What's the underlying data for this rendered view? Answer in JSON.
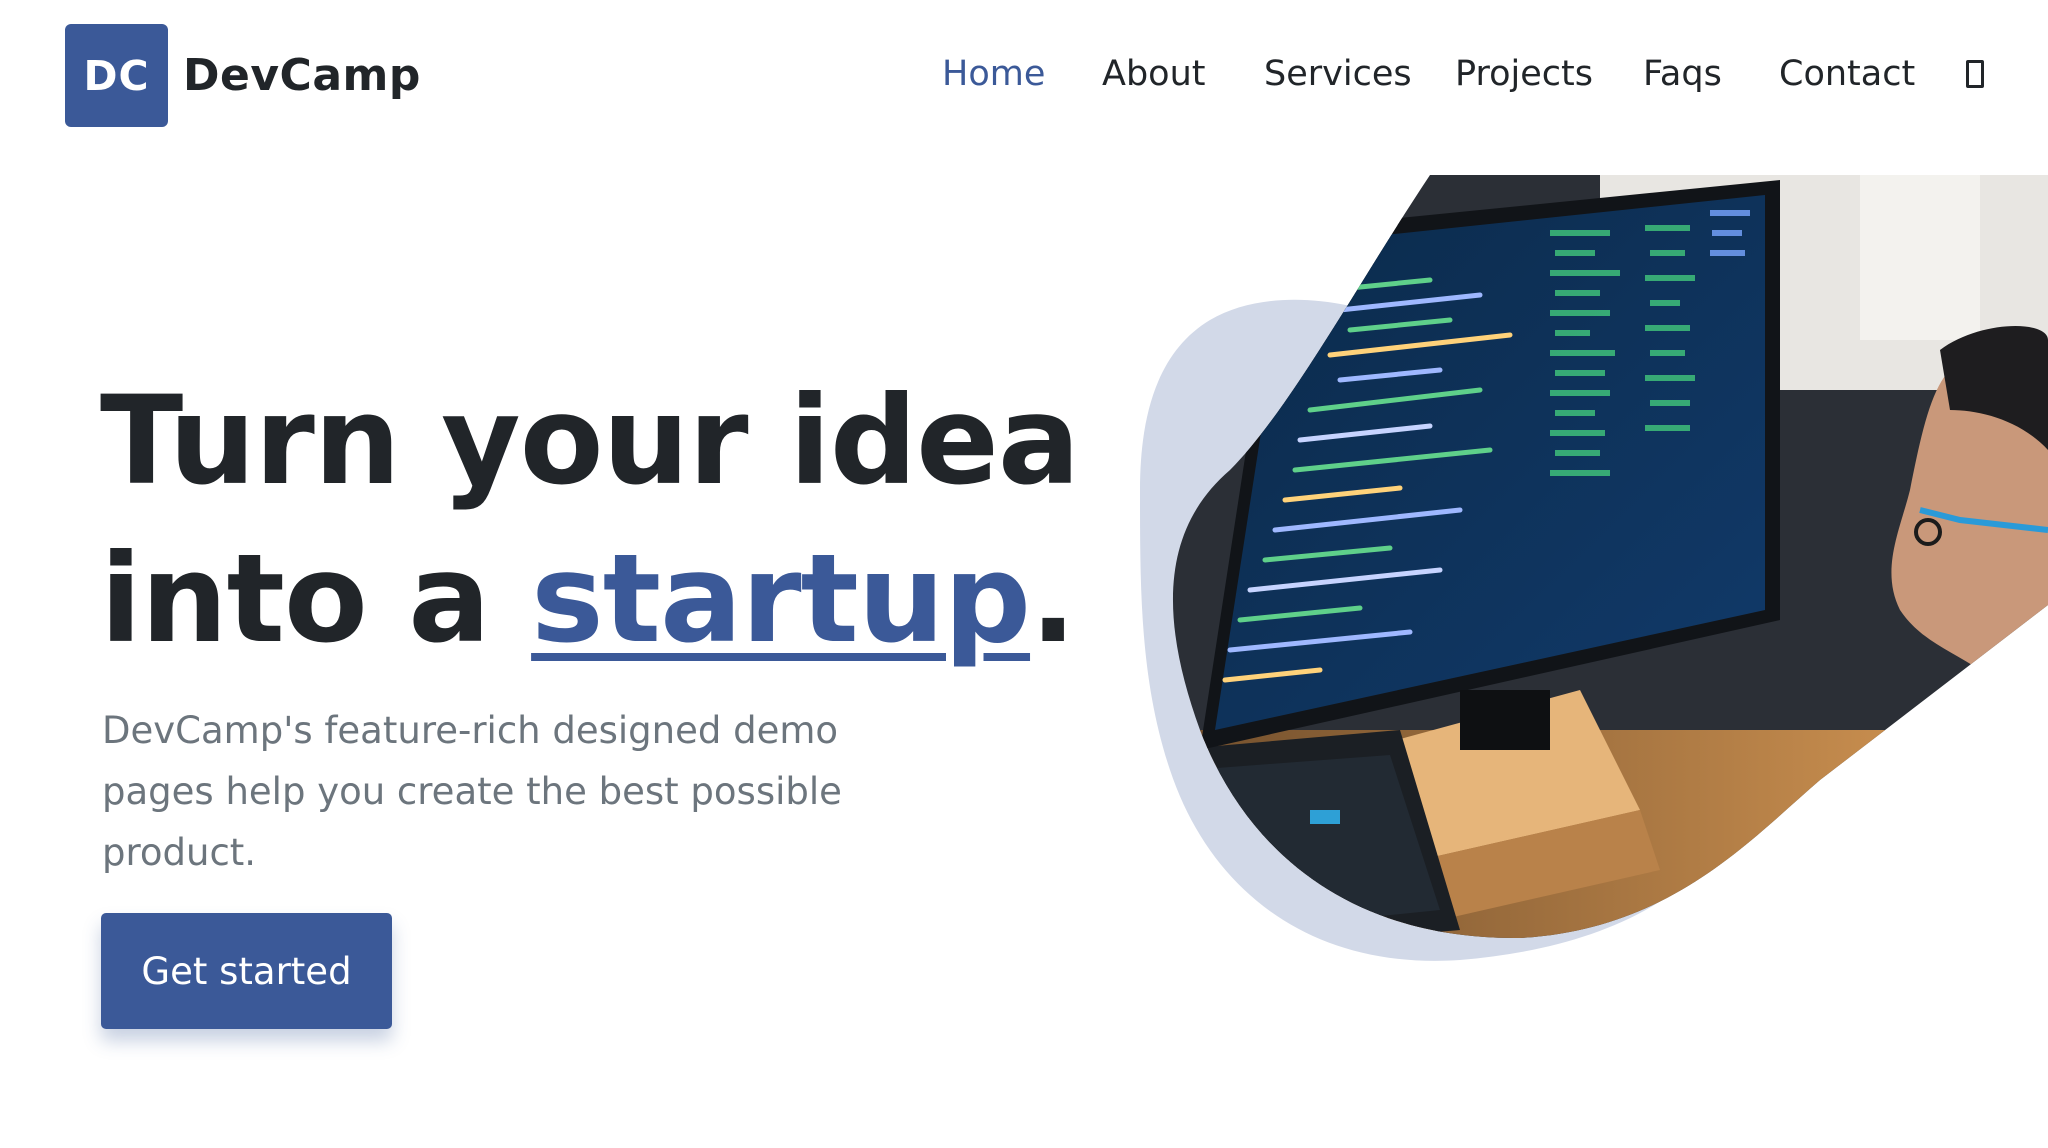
{
  "brand": {
    "logo_initials": "DC",
    "name": "DevCamp"
  },
  "nav": {
    "items": [
      {
        "label": "Home",
        "active": true
      },
      {
        "label": "About"
      },
      {
        "label": "Services"
      },
      {
        "label": "Projects"
      },
      {
        "label": "Faqs"
      },
      {
        "label": "Contact"
      }
    ],
    "theme_icon": "theme-toggle-icon"
  },
  "hero": {
    "title_line1": "Turn your idea",
    "title_line2_prefix": "into a ",
    "title_accent": "startup",
    "title_suffix": ".",
    "description": "DevCamp's feature-rich designed demo pages help you create the best possible product.",
    "cta_label": "Get started",
    "image_alt": "developer-coding-illustration"
  },
  "colors": {
    "primary": "#3b5998",
    "text": "#212529",
    "muted": "#6c757d",
    "blob": "#d2d9e8"
  }
}
